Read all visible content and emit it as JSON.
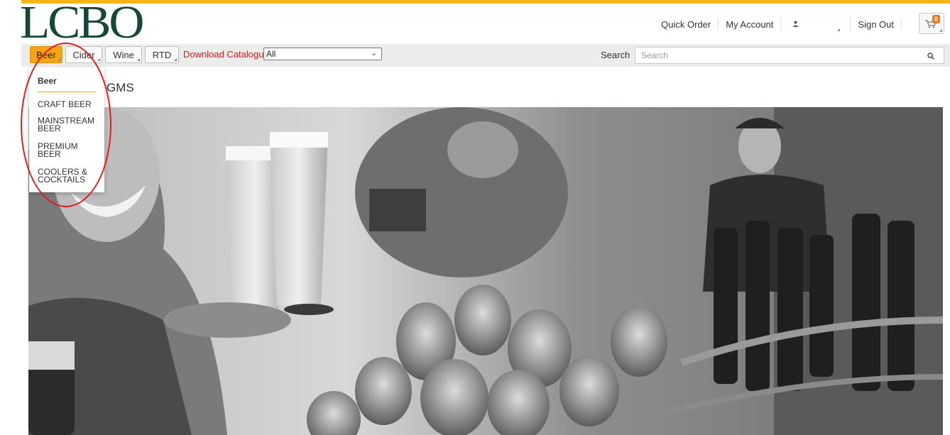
{
  "brand": {
    "logo_text": "LCBO",
    "accent_color": "#f3b51a",
    "logo_color": "#17463b"
  },
  "top_nav": {
    "quick_order": "Quick Order",
    "my_account": "My Account",
    "user_icon": "person-icon",
    "sign_out": "Sign Out",
    "cart_count": "0",
    "cart_icon": "cart-icon"
  },
  "nav": {
    "categories": [
      "Beer",
      "Cider",
      "Wine",
      "RTD"
    ],
    "active_category": "Beer",
    "download_catalogue": "Download Catalogue",
    "filter_value": "All",
    "search_label": "Search",
    "search_placeholder": "Search",
    "search_icon": "magnifier-icon"
  },
  "page": {
    "title": "GMS"
  },
  "dropdown": {
    "heading": "Beer",
    "items": [
      "CRAFT BEER",
      "MAINSTREAM BEER",
      "PREMIUM BEER",
      "COOLERS & COCKTAILS"
    ]
  },
  "annotation": {
    "highlight_color": "#e11d1d"
  }
}
